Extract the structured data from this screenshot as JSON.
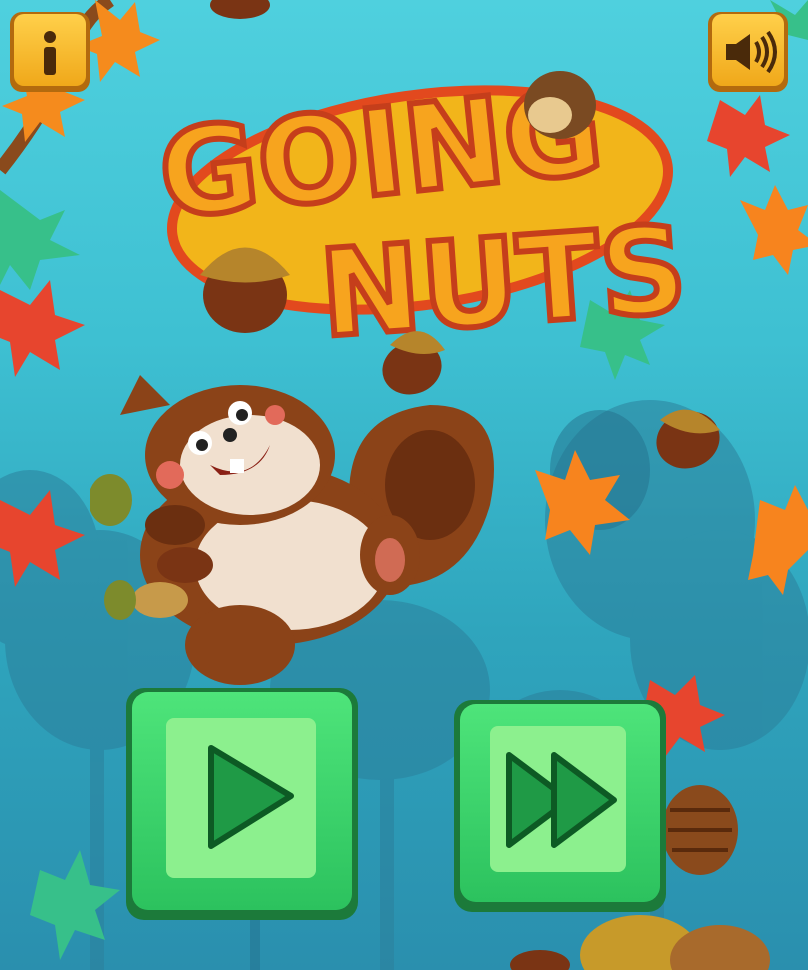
{
  "game": {
    "title_line1": "GOING",
    "title_line2": "NUTS!"
  },
  "buttons": {
    "info": {
      "icon": "info-icon"
    },
    "sound": {
      "icon": "speaker-icon"
    },
    "play": {
      "icon": "play-icon"
    },
    "fast_forward": {
      "icon": "fast-forward-icon"
    }
  },
  "colors": {
    "sky_top": "#4fd0de",
    "sky_bottom": "#2a8fae",
    "title_orange": "#f6a01c",
    "title_outline": "#c0441a",
    "button_green": "#3bd96a",
    "corner_button_gold": "#f4b316"
  }
}
